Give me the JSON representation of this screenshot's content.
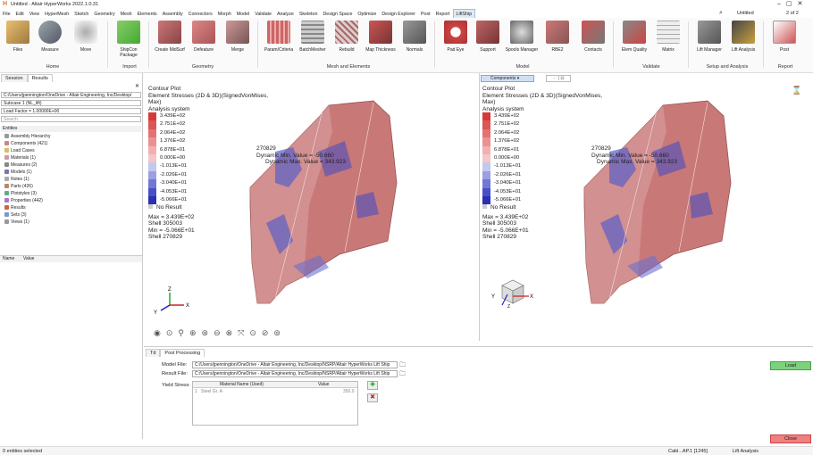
{
  "window": {
    "title": "Untitled - Altair HyperWorks 2022.1.0.31",
    "page_indicator": "2 of 2",
    "view_name": "Untitled"
  },
  "menu": [
    "File",
    "Edit",
    "View",
    "HyperMesh",
    "Sketch",
    "Geometry",
    "Mesh",
    "Elements",
    "Assembly",
    "Connectors",
    "Morph",
    "Model",
    "Validate",
    "Analyze",
    "Skeleton",
    "Design Space",
    "Optimize",
    "Design Explorer",
    "Post",
    "Report",
    "LiftShip"
  ],
  "ribbon": {
    "tools": [
      "Files",
      "Measure",
      "Move",
      "ShipCon Package",
      "Create MidSurf",
      "Defeature",
      "Merge",
      "Param/Criteria",
      "BatchMesher",
      "Rebuild",
      "Map Thickness",
      "Normals",
      "Pad Eye",
      "Support",
      "Spools Manager",
      "RBE2",
      "Contacts",
      "Elem Quality",
      "Matrix",
      "Lift Manager",
      "Lift Analysis",
      "Post"
    ],
    "groups": [
      "Home",
      "Import",
      "Geometry",
      "Mesh and Elements",
      "Model",
      "Validate",
      "Setup and Analysis",
      "Report"
    ]
  },
  "left": {
    "tabs": [
      "Session",
      "Results"
    ],
    "path": "C:/Users/jpennington/OneDrive - Altair Engineering, Inc/Desktop/",
    "subcase": "Subcase 1 (NL_lift)",
    "load_factor": "Load Factor = 1.00000E+00",
    "search_placeholder": "Search",
    "entities_label": "Entities",
    "tree": [
      "Assembly Hierarchy",
      "Components (421)",
      "Load Cases",
      "Materials (1)",
      "Measures (2)",
      "Models (1)",
      "Notes (1)",
      "Parts (426)",
      "Plotstyles (3)",
      "Properties (442)",
      "Results",
      "Sets (3)",
      "Views (1)"
    ],
    "prop_headers": [
      "Name",
      "Value"
    ]
  },
  "contour": {
    "title": "Contour Plot",
    "subtitle": "Element Stresses (2D & 3D)(SignedVonMises, Max)",
    "system": "Analysis system",
    "levels": [
      "3.439E+02",
      "2.751E+02",
      "2.064E+02",
      "1.376E+02",
      "6.878E+01",
      "0.000E+00",
      "-1.013E+01",
      "-2.026E+01",
      "-3.040E+01",
      "-4.053E+01",
      "-5.066E+01"
    ],
    "level_colors": [
      "#d43a3a",
      "#dd5555",
      "#e57272",
      "#ec9090",
      "#f2b0b0",
      "#f6c6c6",
      "#c4c8ee",
      "#9aa0e2",
      "#7078d4",
      "#4a4fc6",
      "#2a2fb4"
    ],
    "no_result": "No Result",
    "max": "Max = 3.439E+02",
    "max_shell": "Shell 305003",
    "min": "Min = -5.066E+01",
    "min_shell": "Shell 270829",
    "probe_id": "270829",
    "probe_min": "Dynamic Min. Value = -50.660",
    "probe_max": "Dynamic Max. Value = 343.923"
  },
  "right_view": {
    "components_label": "Components"
  },
  "bottom": {
    "tabs": [
      "Td",
      "Post Processing"
    ],
    "model_label": "Model File:",
    "model_file": "C:/Users/jpennington/OneDrive - Altair Engineering, Inc/Desktop/NSRP/Altair HyperWorks Lift Ship",
    "result_label": "Result File:",
    "result_file": "C:/Users/jpennington/OneDrive - Altair Engineering, Inc/Desktop/NSRP/Altair HyperWorks Lift Ship",
    "yield_label": "Yield Stress",
    "table_headers": [
      "Material Name (Used)",
      "Value"
    ],
    "table_row": {
      "idx": "1",
      "name": "Steel Gr. A",
      "value": "350.0"
    },
    "load_btn": "Load",
    "close_btn": "Close"
  },
  "status": {
    "left": "0 entities selected",
    "right": "Cabl...AP.1 [1245]",
    "analysis": "Lift Analysis"
  }
}
